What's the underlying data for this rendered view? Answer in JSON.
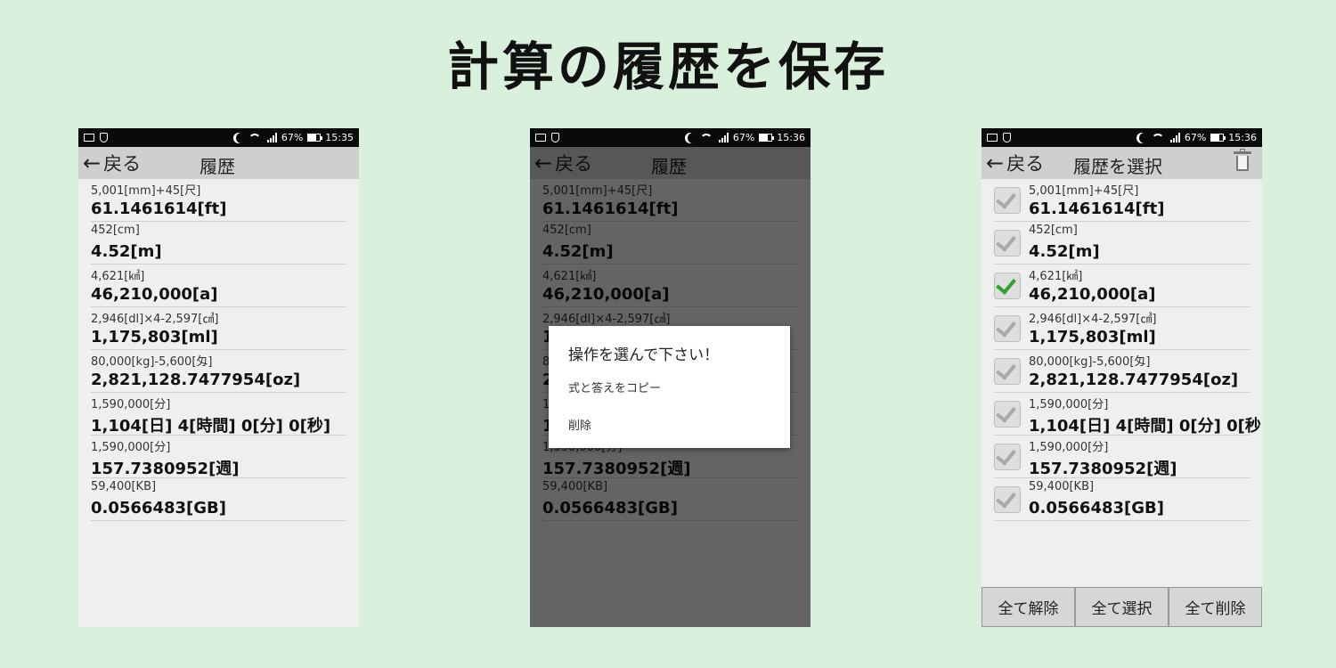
{
  "headline": "計算の履歴を保存",
  "phone1": {
    "status_battery": "67%",
    "status_time": "15:35",
    "back_label": "戻る",
    "title": "履歴"
  },
  "phone2": {
    "status_battery": "67%",
    "status_time": "15:36",
    "back_label": "戻る",
    "title": "履歴",
    "dialog": {
      "title": "操作を選んで下さい！",
      "option_copy": "式と答えをコピー",
      "option_delete": "削除"
    }
  },
  "phone3": {
    "status_battery": "67%",
    "status_time": "15:36",
    "back_label": "戻る",
    "title": "履歴を選択",
    "buttons": {
      "deselect_all": "全て解除",
      "select_all": "全て選択",
      "delete_all": "全て削除"
    },
    "checked": [
      false,
      false,
      true,
      false,
      false,
      false,
      false,
      false
    ]
  },
  "history": [
    {
      "expr": "5,001[mm]+45[尺]",
      "answer": "61.1461614[ft]"
    },
    {
      "expr": "452[cm]",
      "answer": "4.52[m]"
    },
    {
      "expr": "4,621[㎢]",
      "answer": "46,210,000[a]"
    },
    {
      "expr": "2,946[dl]×4-2,597[㎤]",
      "answer": "1,175,803[ml]"
    },
    {
      "expr": "80,000[kg]-5,600[匁]",
      "answer": "2,821,128.7477954[oz]"
    },
    {
      "expr": "1,590,000[分]",
      "answer": "1,104[日] 4[時間] 0[分] 0[秒]"
    },
    {
      "expr": "1,590,000[分]",
      "answer": "157.7380952[週]"
    },
    {
      "expr": "59,400[KB]",
      "answer": "0.0566483[GB]"
    }
  ]
}
